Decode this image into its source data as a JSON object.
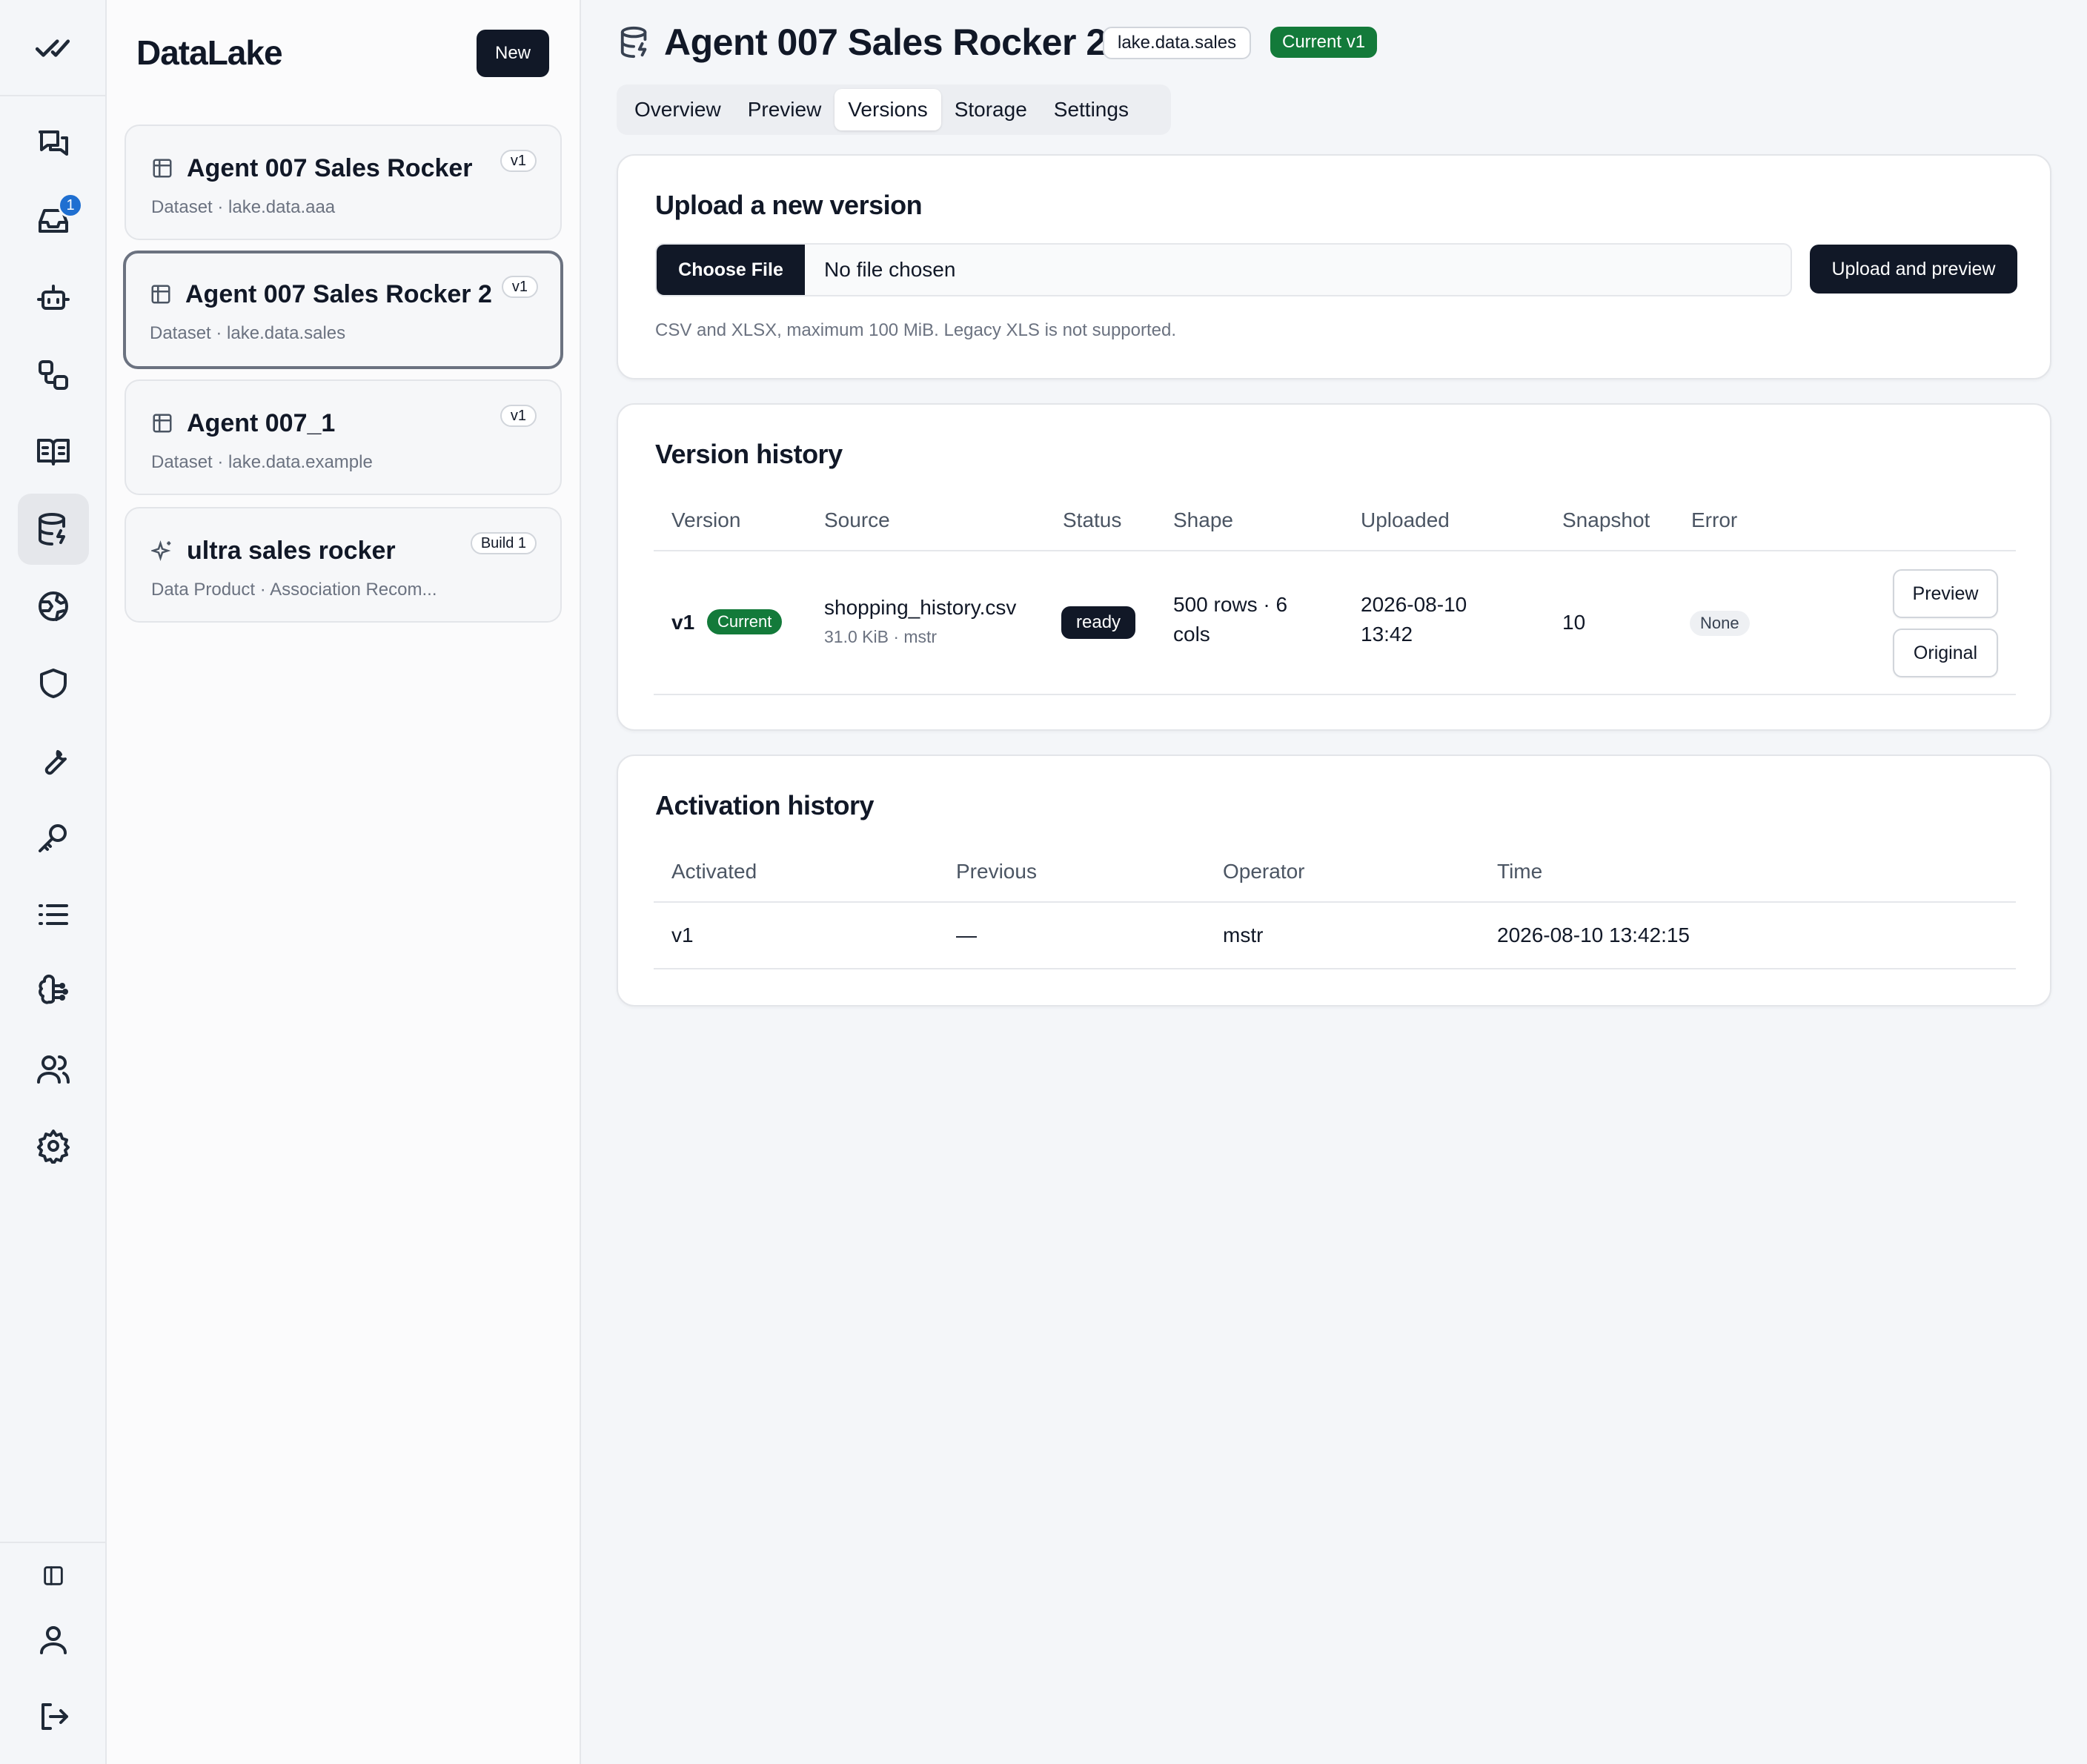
{
  "app": {
    "name": "DataLake",
    "new_label": "New"
  },
  "rail": {
    "inbox_badge": "1",
    "items": [
      "check-all-icon",
      "chat-icon",
      "inbox-icon",
      "bot-icon",
      "workflow-icon",
      "book-icon",
      "database-icon",
      "globe-icon",
      "shield-icon",
      "wrench-icon",
      "key-icon",
      "list-icon",
      "brain-icon",
      "users-icon",
      "settings-icon",
      "panel-icon",
      "user-icon",
      "logout-icon"
    ]
  },
  "datasets": [
    {
      "title": "Agent 007 Sales Rocker",
      "subtitle": "Dataset · lake.data.aaa",
      "pill": "v1",
      "icon": "table-icon"
    },
    {
      "title": "Agent 007 Sales Rocker 2",
      "subtitle": "Dataset · lake.data.sales",
      "pill": "v1",
      "icon": "table-icon",
      "selected": true
    },
    {
      "title": "Agent 007_1",
      "subtitle": "Dataset · lake.data.example",
      "pill": "v1",
      "icon": "table-icon"
    },
    {
      "title": "ultra sales rocker",
      "subtitle": "Data Product · Association Recom...",
      "pill": "Build 1",
      "icon": "sparkle-icon"
    }
  ],
  "header": {
    "title": "Agent 007 Sales Rocker 2",
    "key": "lake.data.sales",
    "current": "Current v1"
  },
  "tabs": [
    "Overview",
    "Preview",
    "Versions",
    "Storage",
    "Settings"
  ],
  "active_tab": "Versions",
  "upload": {
    "title": "Upload a new version",
    "choose_label": "Choose File",
    "no_file": "No file chosen",
    "button": "Upload and preview",
    "hint": "CSV and XLSX, maximum 100 MiB. Legacy XLS is not supported."
  },
  "version_history": {
    "title": "Version history",
    "columns": [
      "Version",
      "Source",
      "Status",
      "Shape",
      "Uploaded",
      "Snapshot",
      "Error"
    ],
    "rows": [
      {
        "version": "v1",
        "current_badge": "Current",
        "source": "shopping_history.csv",
        "source_meta": "31.0 KiB · mstr",
        "status": "ready",
        "shape_line1": "500 rows · 6",
        "shape_line2": "cols",
        "uploaded_line1": "2026-08-10",
        "uploaded_line2": "13:42",
        "snapshot": "10",
        "error": "None",
        "preview_label": "Preview",
        "original_label": "Original"
      }
    ]
  },
  "activation_history": {
    "title": "Activation history",
    "columns": [
      "Activated",
      "Previous",
      "Operator",
      "Time"
    ],
    "rows": [
      {
        "activated": "v1",
        "previous": "—",
        "operator": "mstr",
        "time": "2026-08-10 13:42:15"
      }
    ]
  },
  "colors": {
    "accent_dark": "#111827",
    "success": "#137a3a",
    "badge_blue": "#1f6fd1"
  }
}
